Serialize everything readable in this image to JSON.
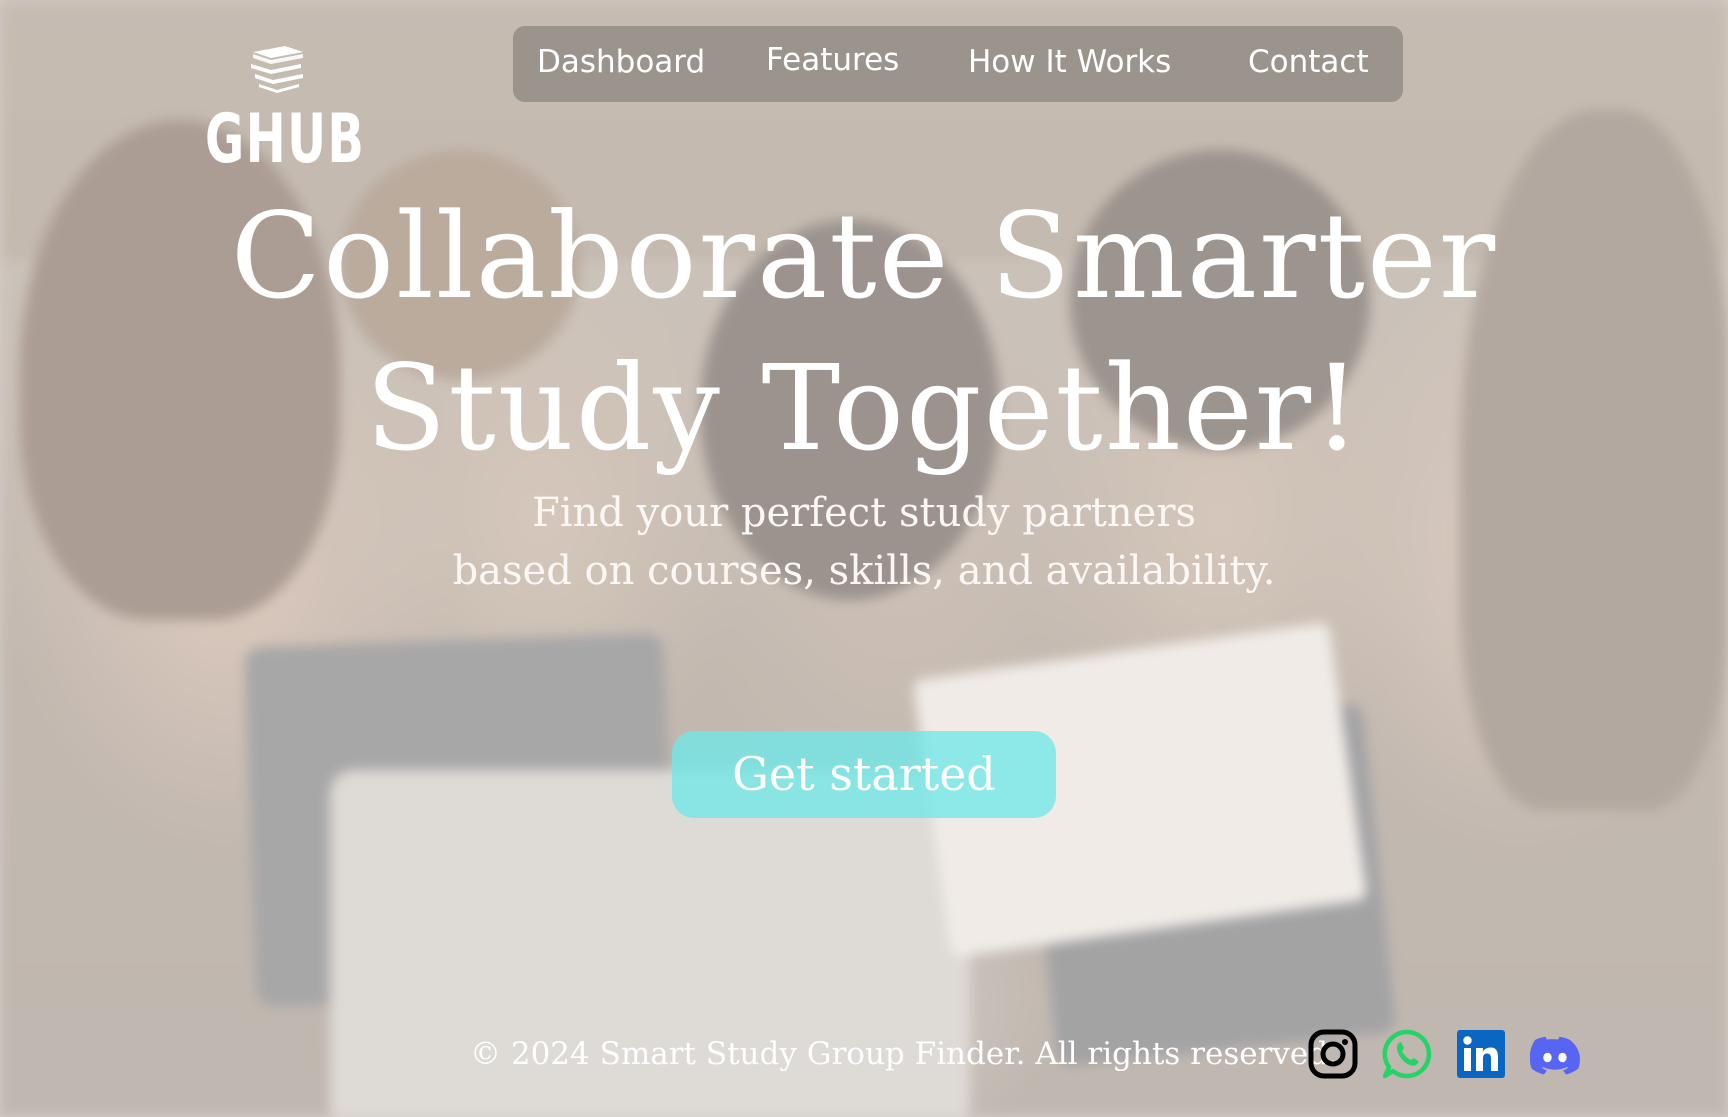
{
  "brand": {
    "name": "GHUB",
    "logo_icon": "stacked-books-icon"
  },
  "nav": {
    "items": [
      {
        "label": "Dashboard"
      },
      {
        "label": "Features"
      },
      {
        "label": "How It Works"
      },
      {
        "label": "Contact"
      }
    ]
  },
  "hero": {
    "title_line1": "Collaborate Smarter",
    "title_line2": "Study Together!",
    "subtitle_line1": "Find your perfect study partners",
    "subtitle_line2": "based on courses, skills, and availability.",
    "cta_label": "Get started"
  },
  "footer": {
    "copyright": "© 2024 Smart Study Group Finder. All rights reserved.",
    "social": [
      {
        "icon": "instagram-icon",
        "color": "#000000"
      },
      {
        "icon": "whatsapp-icon",
        "color": "#25D366"
      },
      {
        "icon": "linkedin-icon",
        "color": "#0A66C2"
      },
      {
        "icon": "discord-icon",
        "color": "#5865F2"
      }
    ]
  },
  "colors": {
    "accent": "#6FE8E8",
    "nav_bg": "#78746F",
    "text": "#FFFFFF"
  }
}
